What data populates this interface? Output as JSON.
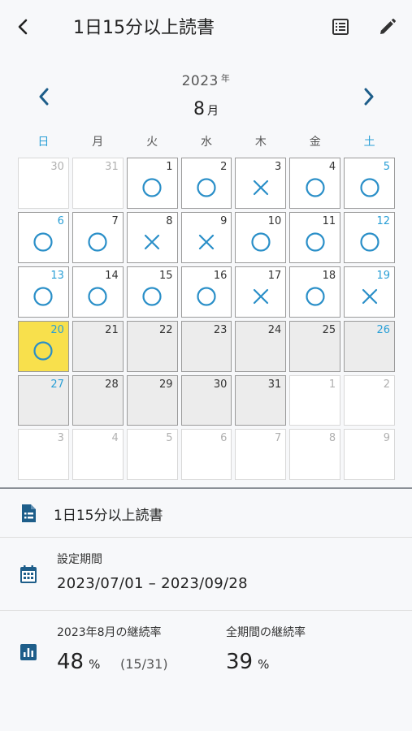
{
  "header": {
    "title": "1日15分以上読書",
    "icons": {
      "back": "chevron-left-icon",
      "list": "list-icon",
      "edit": "pencil-icon"
    }
  },
  "calendar": {
    "year": "2023",
    "year_unit": "年",
    "month": "8",
    "month_unit": "月",
    "weekdays": [
      "日",
      "月",
      "火",
      "水",
      "木",
      "金",
      "土"
    ],
    "days": [
      {
        "d": "30",
        "s": "other",
        "m": ""
      },
      {
        "d": "31",
        "s": "other",
        "m": ""
      },
      {
        "d": "1",
        "s": "cur",
        "m": "o"
      },
      {
        "d": "2",
        "s": "cur",
        "m": "o"
      },
      {
        "d": "3",
        "s": "cur",
        "m": "x"
      },
      {
        "d": "4",
        "s": "cur",
        "m": "o"
      },
      {
        "d": "5",
        "s": "cur",
        "m": "o"
      },
      {
        "d": "6",
        "s": "cur",
        "m": "o"
      },
      {
        "d": "7",
        "s": "cur",
        "m": "o"
      },
      {
        "d": "8",
        "s": "cur",
        "m": "x"
      },
      {
        "d": "9",
        "s": "cur",
        "m": "x"
      },
      {
        "d": "10",
        "s": "cur",
        "m": "o"
      },
      {
        "d": "11",
        "s": "cur",
        "m": "o"
      },
      {
        "d": "12",
        "s": "cur",
        "m": "o"
      },
      {
        "d": "13",
        "s": "cur",
        "m": "o"
      },
      {
        "d": "14",
        "s": "cur",
        "m": "o"
      },
      {
        "d": "15",
        "s": "cur",
        "m": "o"
      },
      {
        "d": "16",
        "s": "cur",
        "m": "o"
      },
      {
        "d": "17",
        "s": "cur",
        "m": "x"
      },
      {
        "d": "18",
        "s": "cur",
        "m": "o"
      },
      {
        "d": "19",
        "s": "cur",
        "m": "x"
      },
      {
        "d": "20",
        "s": "today",
        "m": "o"
      },
      {
        "d": "21",
        "s": "future",
        "m": ""
      },
      {
        "d": "22",
        "s": "future",
        "m": ""
      },
      {
        "d": "23",
        "s": "future",
        "m": ""
      },
      {
        "d": "24",
        "s": "future",
        "m": ""
      },
      {
        "d": "25",
        "s": "future",
        "m": ""
      },
      {
        "d": "26",
        "s": "future",
        "m": ""
      },
      {
        "d": "27",
        "s": "future",
        "m": ""
      },
      {
        "d": "28",
        "s": "future",
        "m": ""
      },
      {
        "d": "29",
        "s": "future",
        "m": ""
      },
      {
        "d": "30",
        "s": "future",
        "m": ""
      },
      {
        "d": "31",
        "s": "future",
        "m": ""
      },
      {
        "d": "1",
        "s": "other",
        "m": ""
      },
      {
        "d": "2",
        "s": "other",
        "m": ""
      },
      {
        "d": "3",
        "s": "other",
        "m": ""
      },
      {
        "d": "4",
        "s": "other",
        "m": ""
      },
      {
        "d": "5",
        "s": "other",
        "m": ""
      },
      {
        "d": "6",
        "s": "other",
        "m": ""
      },
      {
        "d": "7",
        "s": "other",
        "m": ""
      },
      {
        "d": "8",
        "s": "other",
        "m": ""
      },
      {
        "d": "9",
        "s": "other",
        "m": ""
      }
    ]
  },
  "info": {
    "goal_icon": "document-icon",
    "goal_name": "1日15分以上読書",
    "period_icon": "calendar-icon",
    "period_label": "設定期間",
    "period_value": "2023/07/01 – 2023/09/28",
    "stats_icon": "bar-chart-icon",
    "month_rate_label": "2023年8月の継続率",
    "month_rate_value": "48",
    "month_rate_unit": "%",
    "month_rate_count": "(15/31)",
    "total_rate_label": "全期間の継続率",
    "total_rate_value": "39",
    "total_rate_unit": "%"
  },
  "colors": {
    "accent": "#1e5e8a",
    "mark": "#2a8fc8",
    "weekend": "#2a9fd6",
    "today": "#f8e04c",
    "future": "#ececec"
  }
}
